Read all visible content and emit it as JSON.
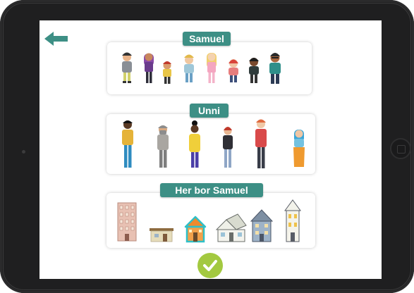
{
  "sections": {
    "friends_title": "Samuel",
    "grown_up_title": "Unni",
    "home_title": "Her bor Samuel"
  },
  "icons": {
    "back": "arrow-left-icon",
    "confirm": "checkmark-icon"
  },
  "colors": {
    "accent": "#3d8f85",
    "confirm": "#a3c940"
  }
}
